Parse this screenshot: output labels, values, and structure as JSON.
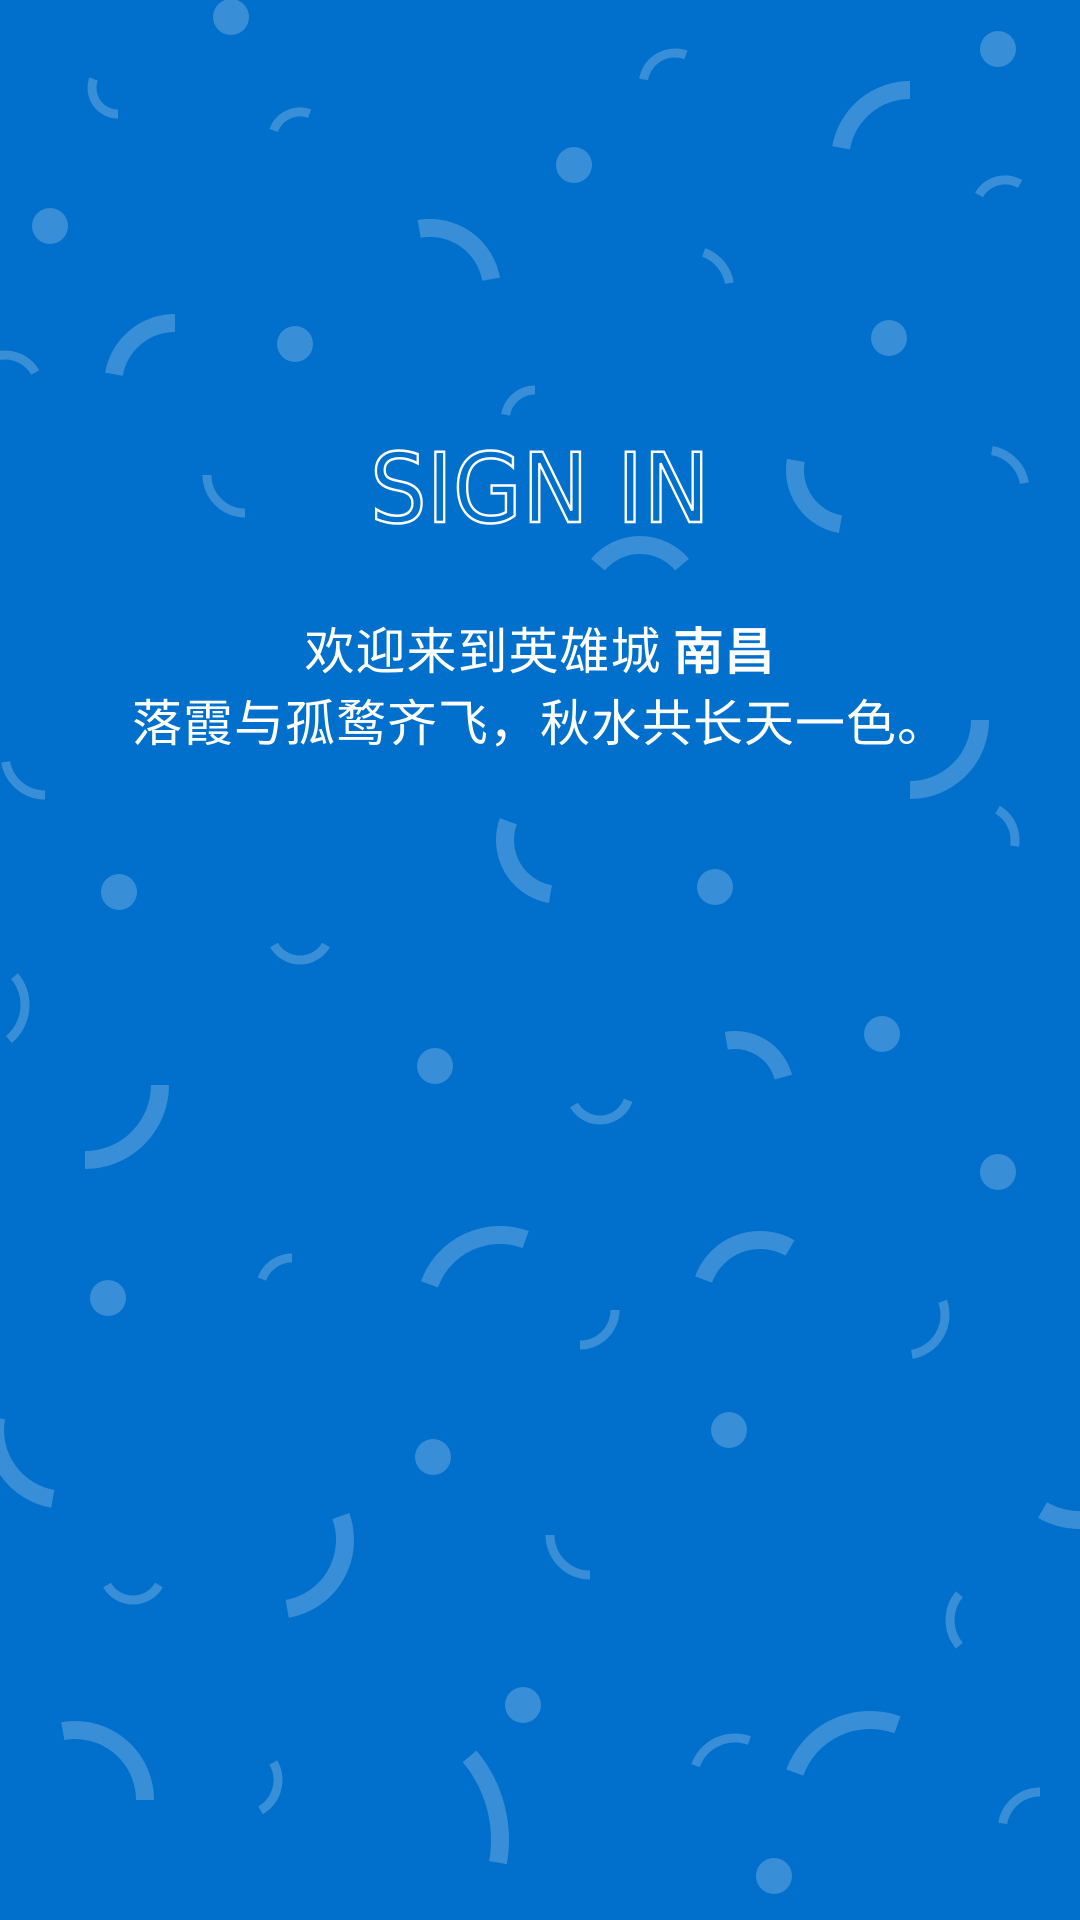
{
  "title": "SIGN IN",
  "welcome": {
    "text": "欢迎来到英雄城",
    "city": "南昌"
  },
  "poem": "落霞与孤鹜齐飞，秋水共长天一色。",
  "colors": {
    "background": "#0070cc",
    "decor": "#ffffff",
    "text": "#ffffff"
  }
}
